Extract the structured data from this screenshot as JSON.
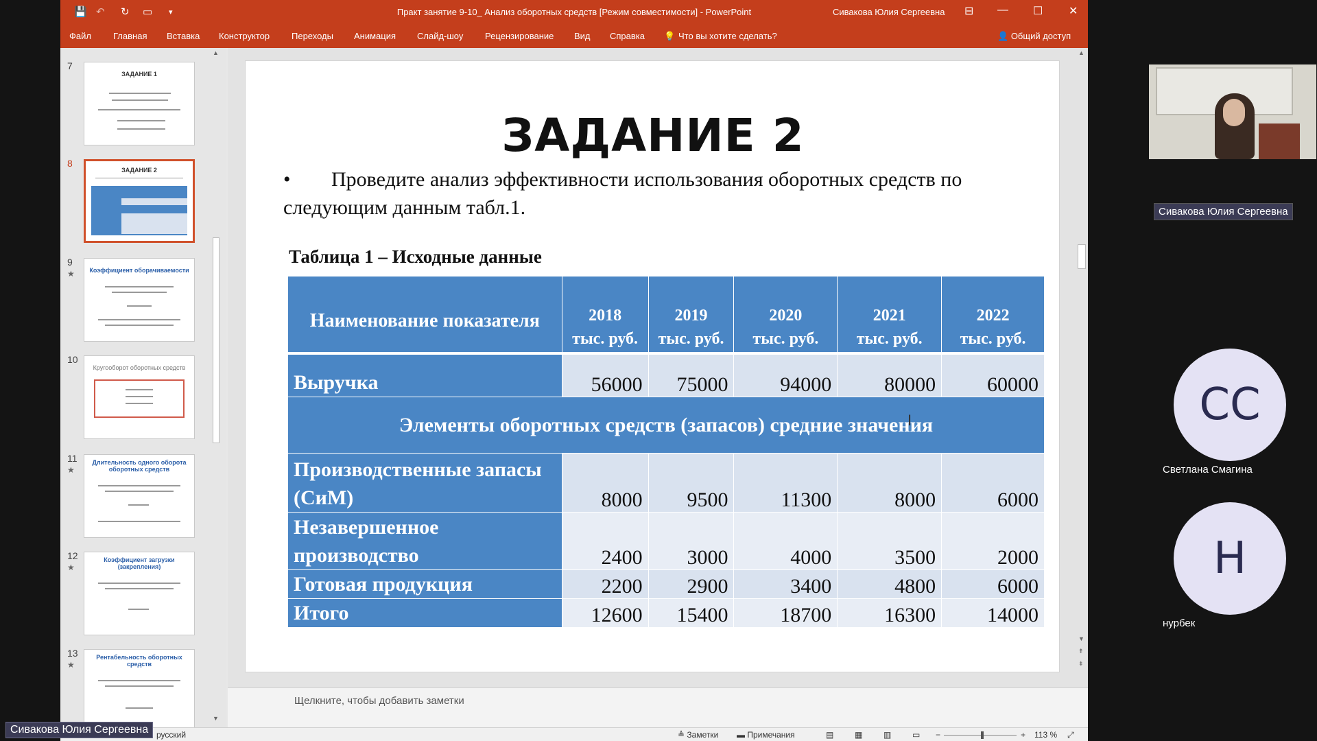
{
  "window": {
    "title": "Практ занятие 9-10_ Анализ оборотных средств [Режим совместимости]  -  PowerPoint",
    "user": "Сивакова Юлия Сергеевна"
  },
  "quick_access": {
    "save_icon": "💾",
    "undo_icon": "↶",
    "redo_icon": "↻",
    "present_icon": "▭",
    "more_icon": "▾"
  },
  "window_controls": {
    "ribbon_display": "⊟",
    "minimize": "—",
    "maximize": "☐",
    "close": "✕"
  },
  "ribbon": {
    "tabs": [
      "Файл",
      "Главная",
      "Вставка",
      "Конструктор",
      "Переходы",
      "Анимация",
      "Слайд-шоу",
      "Рецензирование",
      "Вид",
      "Справка"
    ],
    "tell_me": "Что вы хотите сделать?",
    "share": "Общий доступ"
  },
  "thumbnails": [
    {
      "num": "7",
      "title": "ЗАДАНИЕ 1",
      "star": false,
      "selected": false
    },
    {
      "num": "8",
      "title": "ЗАДАНИЕ 2",
      "star": false,
      "selected": true
    },
    {
      "num": "9",
      "title": "Коэффициент оборачиваемости",
      "star": true,
      "selected": false
    },
    {
      "num": "10",
      "title": "Кругооборот оборотных средств",
      "star": false,
      "selected": false
    },
    {
      "num": "11",
      "title": "Длительность одного оборота оборотных средств",
      "star": true,
      "selected": false
    },
    {
      "num": "12",
      "title": "Коэффициент загрузки (закрепления)",
      "star": true,
      "selected": false
    },
    {
      "num": "13",
      "title": "Рентабельность оборотных средств",
      "star": true,
      "selected": false
    }
  ],
  "slide": {
    "title": "ЗАДАНИЕ 2",
    "bullet_mark": "•",
    "bullet": "Проведите анализ эффективности использования оборотных средств по следующим данным табл.1.",
    "table_caption": "Таблица 1 – Исходные данные",
    "table": {
      "header_label": "Наименование показателя",
      "years": [
        "2018",
        "2019",
        "2020",
        "2021",
        "2022"
      ],
      "unit": "тыс. руб.",
      "revenue": {
        "label": "Выручка",
        "values": [
          "56000",
          "75000",
          "94000",
          "80000",
          "60000"
        ]
      },
      "section": "Элементы оборотных средств (запасов) средние значения",
      "rows": [
        {
          "label": "Производственные запасы (СиМ)",
          "values": [
            "8000",
            "9500",
            "11300",
            "8000",
            "6000"
          ]
        },
        {
          "label": "Незавершенное производство",
          "values": [
            "2400",
            "3000",
            "4000",
            "3500",
            "2000"
          ]
        },
        {
          "label": "Готовая продукция",
          "values": [
            "2200",
            "2900",
            "3400",
            "4800",
            "6000"
          ]
        },
        {
          "label": "Итого",
          "values": [
            "12600",
            "15400",
            "18700",
            "16300",
            "14000"
          ]
        }
      ]
    }
  },
  "notes_placeholder": "Щелкните, чтобы добавить заметки",
  "status": {
    "language": "русский",
    "notes": "Заметки",
    "comments": "Примечания",
    "zoom": "113 %"
  },
  "participants": {
    "presenter": "Сивакова Юлия Сергеевна",
    "p1_initials": "СС",
    "p1_name": "Светлана Смагина",
    "p2_initials": "Н",
    "p2_name": "нурбек"
  }
}
